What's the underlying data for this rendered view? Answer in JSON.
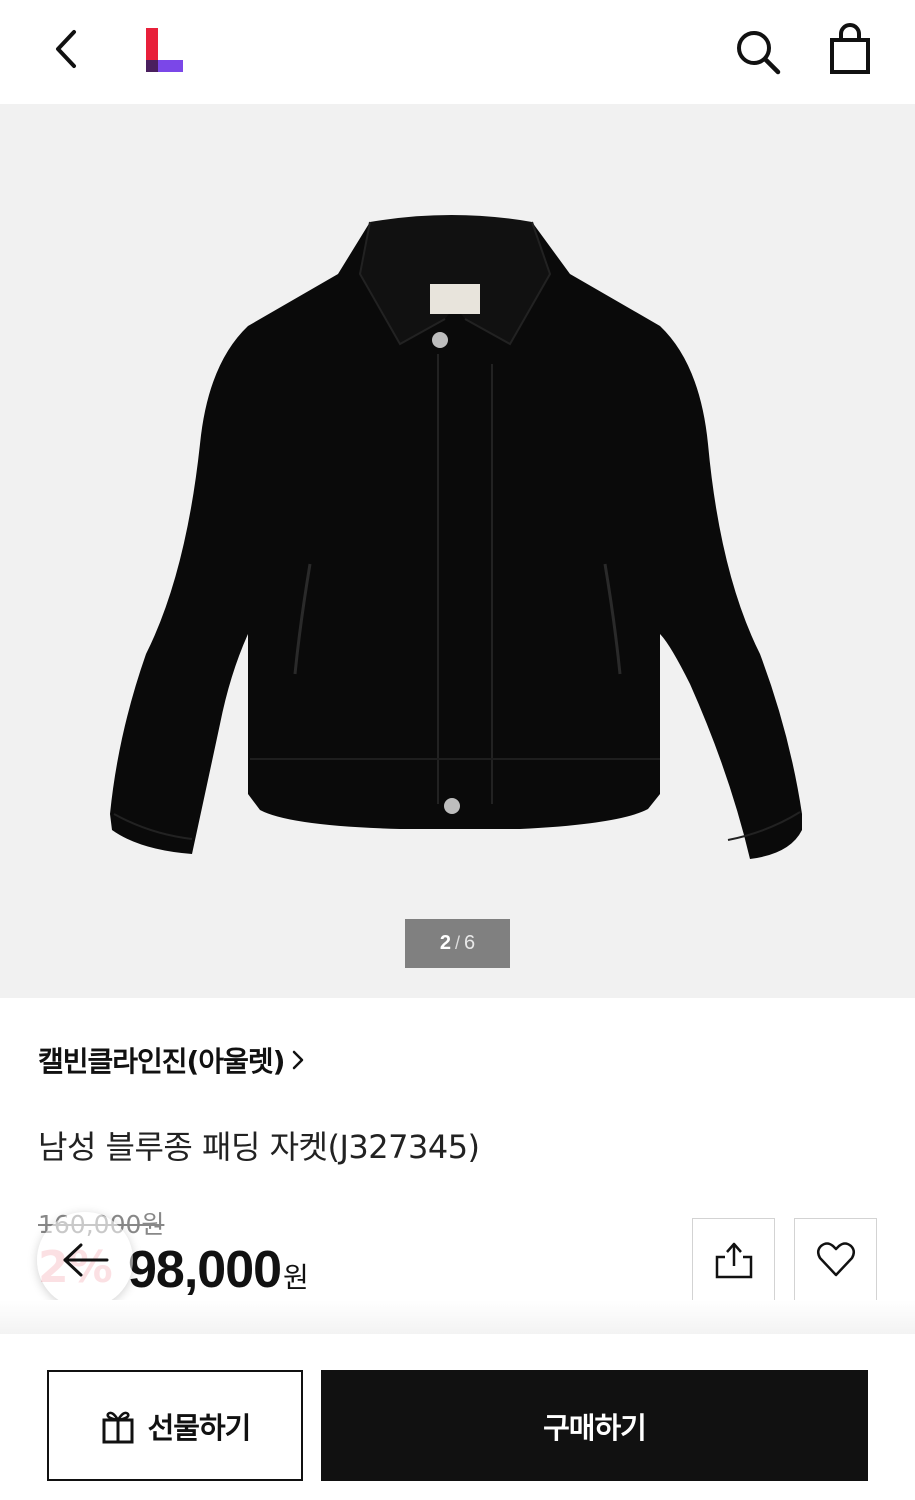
{
  "header": {
    "back_icon": "chevron-left-icon",
    "logo_colors": {
      "red": "#e8203a",
      "purple": "#7b47e8",
      "dark": "#3a1f6b"
    },
    "search_icon": "search-icon",
    "cart_icon": "shopping-bag-icon"
  },
  "gallery": {
    "image_description": "black blouson padded jacket",
    "current": "2",
    "separator": "/",
    "total": "6"
  },
  "product": {
    "brand": "캘빈클라인진(아울렛)",
    "title": "남성 블루종 패딩 자켓(J327345)",
    "original_price": "160,000원",
    "discount": "2%",
    "price": "98,000",
    "currency": "원"
  },
  "actions": {
    "share_icon": "share-icon",
    "wish_icon": "heart-icon",
    "floating_back_icon": "arrow-left-icon"
  },
  "bottom": {
    "gift_label": "선물하기",
    "buy_label": "구매하기"
  },
  "colors": {
    "accent": "#e8203a",
    "primary": "#111111"
  }
}
